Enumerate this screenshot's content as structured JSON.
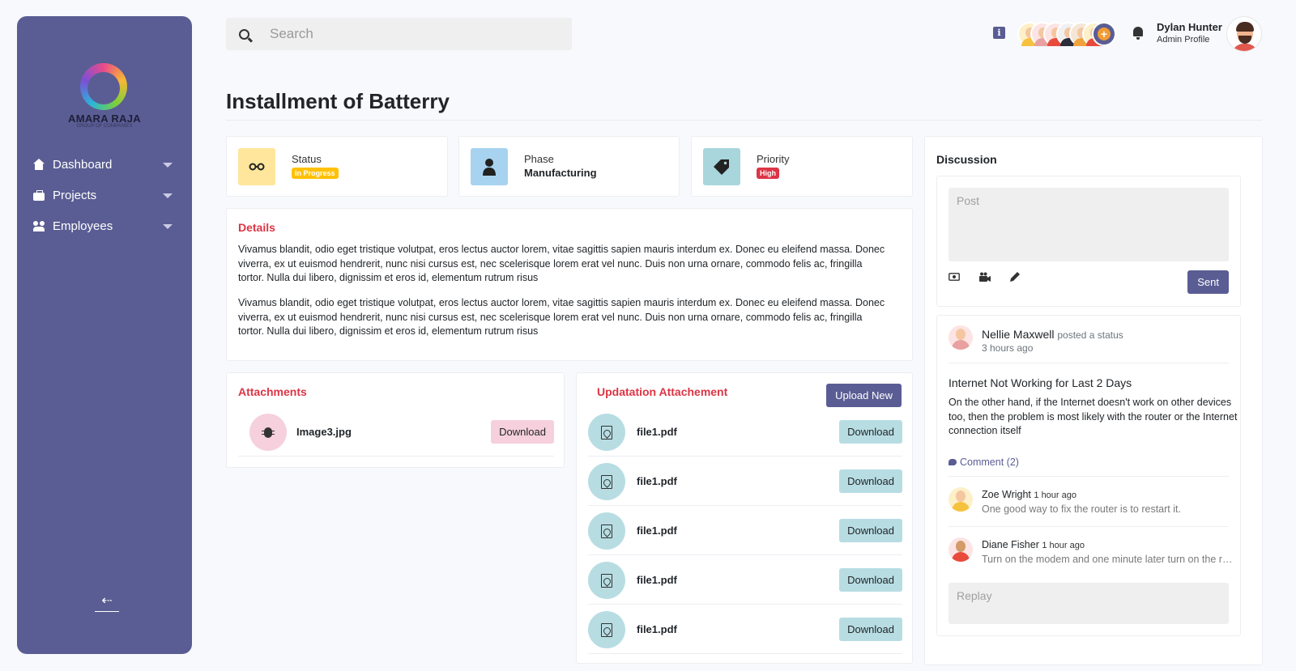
{
  "sidebar": {
    "logo_text": "AMARA RAJA",
    "logo_sub": "GROUP OF COMPANIES",
    "items": [
      {
        "label": "Dashboard",
        "icon": "home-icon"
      },
      {
        "label": "Projects",
        "icon": "briefcase-icon"
      },
      {
        "label": "Employees",
        "icon": "users-icon"
      }
    ],
    "logout_icon": "logout-icon",
    "bg_color": "#5a5d93"
  },
  "header": {
    "search_placeholder": "Search",
    "info_label": "i",
    "team_add_label": "+",
    "user_name": "Dylan Hunter",
    "user_role": "Admin Profile"
  },
  "page": {
    "title": "Installment of Batterry"
  },
  "stats": [
    {
      "label": "Status",
      "badge": "In Progress",
      "badge_color": "#ffc107",
      "icon": "glasses-icon",
      "icon_bg": "#ffe69c"
    },
    {
      "label": "Phase",
      "value": "Manufacturing",
      "icon": "user-icon",
      "icon_bg": "#a7d3f0"
    },
    {
      "label": "Priority",
      "badge": "High",
      "badge_color": "#dc3545",
      "icon": "tag-icon",
      "icon_bg": "#a8d6dc"
    }
  ],
  "details": {
    "title": "Details",
    "paragraphs": [
      "Vivamus blandit, odio eget tristique volutpat, eros lectus auctor lorem, vitae sagittis sapien mauris interdum ex. Donec eu eleifend massa. Donec viverra, ex ut euismod hendrerit, nunc nisi cursus est, nec scelerisque lorem erat vel nunc. Duis non urna ornare, commodo felis ac, fringilla tortor. Nulla dui libero, dignissim et eros id, elementum rutrum risus",
      "Vivamus blandit, odio eget tristique volutpat, eros lectus auctor lorem, vitae sagittis sapien mauris interdum ex. Donec eu eleifend massa. Donec viverra, ex ut euismod hendrerit, nunc nisi cursus est, nec scelerisque lorem erat vel nunc. Duis non urna ornare, commodo felis ac, fringilla tortor. Nulla dui libero, dignissim et eros id, elementum rutrum risus"
    ]
  },
  "attachments": {
    "title": "Attachments",
    "files": [
      {
        "name": "Image3.jpg",
        "button": "Download",
        "icon": "bug-icon"
      }
    ]
  },
  "updates": {
    "title": "Updatation Attachement",
    "upload_label": "Upload New",
    "files": [
      {
        "name": "file1.pdf",
        "button": "Download"
      },
      {
        "name": "file1.pdf",
        "button": "Download"
      },
      {
        "name": "file1.pdf",
        "button": "Download"
      },
      {
        "name": "file1.pdf",
        "button": "Download"
      },
      {
        "name": "file1.pdf",
        "button": "Download"
      }
    ]
  },
  "discussion": {
    "title": "Discussion",
    "post_placeholder": "Post",
    "tools": [
      "camera-icon",
      "video-icon",
      "pen-icon"
    ],
    "send_label": "Sent",
    "post": {
      "author": "Nellie Maxwell",
      "action": "posted a status",
      "time": "3 hours ago",
      "heading": "Internet Not Working for Last 2 Days",
      "body": "On the other hand, if the Internet doesn't work on other devices too, then the problem is most likely with the router or the Internet connection itself",
      "comment_label": "Comment (2)"
    },
    "comments": [
      {
        "author": "Zoe Wright",
        "time": "1 hour ago",
        "text": "One good way to fix the router is to restart it."
      },
      {
        "author": "Diane Fisher",
        "time": "1 hour ago",
        "text": "Turn on the modem and one minute later turn on the router."
      }
    ],
    "reply_placeholder": "Replay"
  }
}
